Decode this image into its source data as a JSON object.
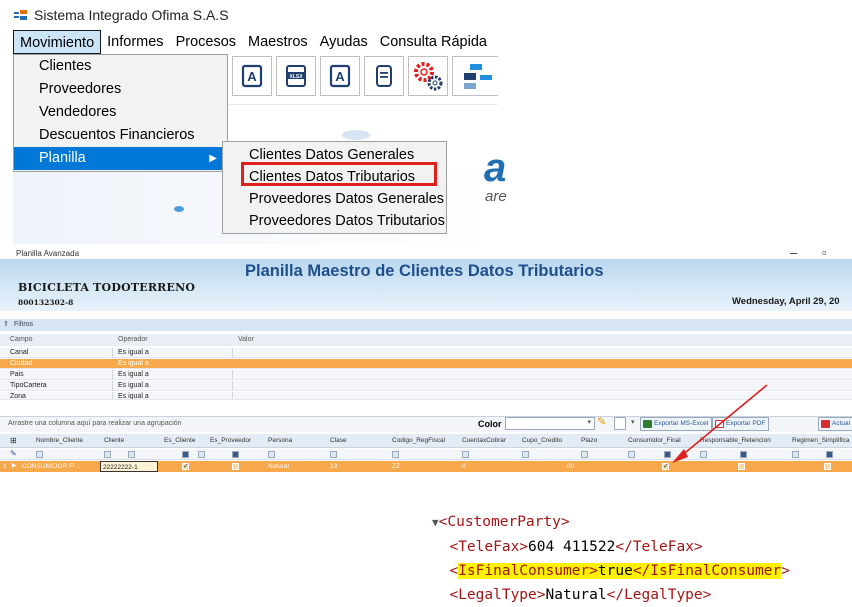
{
  "app": {
    "title": "Sistema Integrado Ofima S.A.S",
    "menu": [
      "Movimiento",
      "Informes",
      "Procesos",
      "Maestros",
      "Ayudas",
      "Consulta Rápida"
    ],
    "dropdown": [
      "Clientes",
      "Proveedores",
      "Vendedores",
      "Descuentos Financieros",
      "Planilla"
    ],
    "submenu": [
      "Clientes Datos Generales",
      "Clientes Datos Tributarios",
      "Proveedores Datos Generales",
      "Proveedores Datos Tributarios"
    ],
    "splash_text": "are",
    "toolbar_icons": [
      "pdf-icon",
      "xlsx-icon",
      "pdf-icon",
      "document-icon",
      "settings-icon",
      "flow-icon"
    ]
  },
  "planilla": {
    "window_title": "Planilla Avanzada",
    "heading": "Planilla Maestro de Clientes Datos Tributarios",
    "company": "BICICLETA TODOTERRENO",
    "nit": "800132302-8",
    "date": "Wednesday, April 29, 20",
    "filters_label": "Filtros",
    "filters_headers": [
      "Campo",
      "Operador",
      "Valor"
    ],
    "filters": [
      {
        "campo": "Canal",
        "operador": "Es igual a"
      },
      {
        "campo": "Ciudad",
        "operador": "Es igual a"
      },
      {
        "campo": "Pais",
        "operador": "Es igual a"
      },
      {
        "campo": "TipoCartera",
        "operador": "Es igual a"
      },
      {
        "campo": "Zona",
        "operador": "Es igual a"
      }
    ],
    "group_hint": "Arrastre una columna aquí para realizar una agrupación",
    "color_label": "Color",
    "export_excel": "Exportar MS-Excel",
    "export_pdf": "Exportar PDF",
    "update": "Actual",
    "columns": [
      "Nombre_Cliente",
      "Cliente",
      "Es_Cliente",
      "Es_Proveedor",
      "Persona",
      "Clase",
      "Codigo_RegFiscal",
      "CuentaxCobrar",
      "Cupo_Credito",
      "Plazo",
      "Consumidor_Final",
      "Responsable_Retencion",
      "Regimen_Simplifica"
    ],
    "row": {
      "index": "1",
      "nombre": "CONSUMIDOR FI...",
      "cliente": "22222222-1",
      "persona": "Natural",
      "clase": "13",
      "codigo": "ZZ",
      "cuenta": "0",
      "cupo": ".00"
    }
  },
  "xml": {
    "open": "<CustomerParty>",
    "telefax_open": "<TeleFax>",
    "telefax_value": "604 411522",
    "telefax_close": "</TeleFax>",
    "final_open_lt": "<",
    "final_tag": "IsFinalConsumer",
    "final_open_gt": ">",
    "final_value": "true",
    "final_close_lt": "</",
    "final_close_tag": "IsFinalConsumer",
    "final_close_gt": ">",
    "legal_open": "<LegalType>",
    "legal_value": "Natural",
    "legal_close": "</LegalType>"
  }
}
